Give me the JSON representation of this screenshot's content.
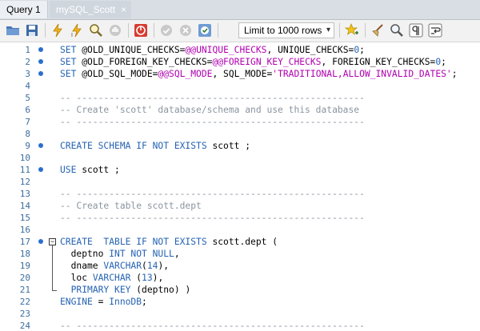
{
  "tabs": [
    {
      "label": "Query 1"
    },
    {
      "label": "mySQL_Scott",
      "close": "×"
    }
  ],
  "toolbar": {
    "limit_select": {
      "value": "Limit to 1000 rows",
      "arrow": "▾"
    }
  },
  "editor": {
    "lines": [
      {
        "n": "1",
        "marker": true,
        "tokens": [
          {
            "t": "SET ",
            "c": "kw"
          },
          {
            "t": "@OLD_UNIQUE_CHECKS",
            "c": "plain"
          },
          {
            "t": "=",
            "c": "plain"
          },
          {
            "t": "@@UNIQUE_CHECKS",
            "c": "var"
          },
          {
            "t": ", UNIQUE_CHECKS=",
            "c": "plain"
          },
          {
            "t": "0",
            "c": "num"
          },
          {
            "t": ";",
            "c": "plain"
          }
        ]
      },
      {
        "n": "2",
        "marker": true,
        "tokens": [
          {
            "t": "SET ",
            "c": "kw"
          },
          {
            "t": "@OLD_FOREIGN_KEY_CHECKS=",
            "c": "plain"
          },
          {
            "t": "@@FOREIGN_KEY_CHECKS",
            "c": "var"
          },
          {
            "t": ", FOREIGN_KEY_CHECKS=",
            "c": "plain"
          },
          {
            "t": "0",
            "c": "num"
          },
          {
            "t": ";",
            "c": "plain"
          }
        ]
      },
      {
        "n": "3",
        "marker": true,
        "tokens": [
          {
            "t": "SET ",
            "c": "kw"
          },
          {
            "t": "@OLD_SQL_MODE=",
            "c": "plain"
          },
          {
            "t": "@@SQL_MODE",
            "c": "var"
          },
          {
            "t": ", SQL_MODE=",
            "c": "plain"
          },
          {
            "t": "'TRADITIONAL,ALLOW_INVALID_DATES'",
            "c": "str"
          },
          {
            "t": ";",
            "c": "plain"
          }
        ]
      },
      {
        "n": "4",
        "marker": false,
        "tokens": []
      },
      {
        "n": "5",
        "marker": false,
        "tokens": [
          {
            "t": "-- -----------------------------------------------------",
            "c": "cmt"
          }
        ]
      },
      {
        "n": "6",
        "marker": false,
        "tokens": [
          {
            "t": "-- Create 'scott' database/schema and use this database",
            "c": "cmt"
          }
        ]
      },
      {
        "n": "7",
        "marker": false,
        "tokens": [
          {
            "t": "-- -----------------------------------------------------",
            "c": "cmt"
          }
        ]
      },
      {
        "n": "8",
        "marker": false,
        "tokens": []
      },
      {
        "n": "9",
        "marker": true,
        "tokens": [
          {
            "t": "CREATE SCHEMA IF NOT EXISTS ",
            "c": "kw"
          },
          {
            "t": "scott ;",
            "c": "plain"
          }
        ]
      },
      {
        "n": "10",
        "marker": false,
        "tokens": []
      },
      {
        "n": "11",
        "marker": true,
        "tokens": [
          {
            "t": "USE ",
            "c": "kw"
          },
          {
            "t": "scott ;",
            "c": "plain"
          }
        ]
      },
      {
        "n": "12",
        "marker": false,
        "tokens": []
      },
      {
        "n": "13",
        "marker": false,
        "tokens": [
          {
            "t": "-- -----------------------------------------------------",
            "c": "cmt"
          }
        ]
      },
      {
        "n": "14",
        "marker": false,
        "tokens": [
          {
            "t": "-- Create table scott.dept",
            "c": "cmt"
          }
        ]
      },
      {
        "n": "15",
        "marker": false,
        "tokens": [
          {
            "t": "-- -----------------------------------------------------",
            "c": "cmt"
          }
        ]
      },
      {
        "n": "16",
        "marker": false,
        "tokens": []
      },
      {
        "n": "17",
        "marker": true,
        "fold": "start",
        "tokens": [
          {
            "t": "CREATE  TABLE IF NOT EXISTS ",
            "c": "kw"
          },
          {
            "t": "scott.dept (",
            "c": "plain"
          }
        ]
      },
      {
        "n": "18",
        "marker": false,
        "tokens": [
          {
            "t": "  deptno ",
            "c": "plain"
          },
          {
            "t": "INT NOT NULL",
            "c": "kw"
          },
          {
            "t": ",",
            "c": "plain"
          }
        ]
      },
      {
        "n": "19",
        "marker": false,
        "tokens": [
          {
            "t": "  dname ",
            "c": "plain"
          },
          {
            "t": "VARCHAR",
            "c": "kw"
          },
          {
            "t": "(",
            "c": "plain"
          },
          {
            "t": "14",
            "c": "num"
          },
          {
            "t": "),",
            "c": "plain"
          }
        ]
      },
      {
        "n": "20",
        "marker": false,
        "tokens": [
          {
            "t": "  loc ",
            "c": "plain"
          },
          {
            "t": "VARCHAR",
            "c": "kw"
          },
          {
            "t": " (",
            "c": "plain"
          },
          {
            "t": "13",
            "c": "num"
          },
          {
            "t": "),",
            "c": "plain"
          }
        ]
      },
      {
        "n": "21",
        "marker": false,
        "fold": "end",
        "tokens": [
          {
            "t": "  ",
            "c": "plain"
          },
          {
            "t": "PRIMARY KEY",
            "c": "kw"
          },
          {
            "t": " (deptno) )",
            "c": "plain"
          }
        ]
      },
      {
        "n": "22",
        "marker": false,
        "tokens": [
          {
            "t": "ENGINE",
            "c": "kw"
          },
          {
            "t": " = ",
            "c": "plain"
          },
          {
            "t": "InnoDB",
            "c": "kw"
          },
          {
            "t": ";",
            "c": "plain"
          }
        ]
      },
      {
        "n": "23",
        "marker": false,
        "tokens": []
      },
      {
        "n": "24",
        "marker": false,
        "tokens": [
          {
            "t": "-- -----------------------------------------------------",
            "c": "cmt"
          }
        ]
      }
    ]
  }
}
